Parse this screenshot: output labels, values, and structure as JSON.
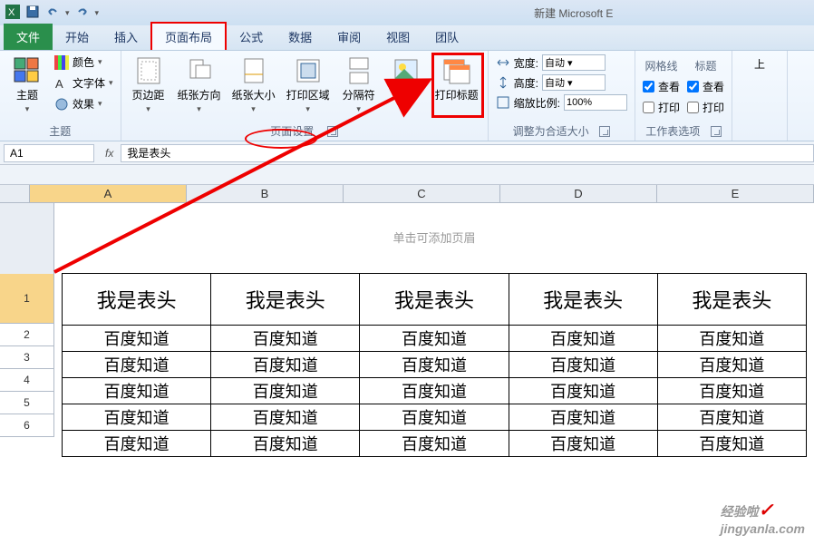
{
  "title": "新建 Microsoft E",
  "qat": {
    "save": "保存",
    "undo": "撤销",
    "redo": "重做"
  },
  "tabs": {
    "file": "文件",
    "home": "开始",
    "insert": "插入",
    "layout": "页面布局",
    "formulas": "公式",
    "data": "数据",
    "review": "审阅",
    "view": "视图",
    "team": "团队"
  },
  "ribbon": {
    "themes": {
      "theme": "主题",
      "colors": "颜色",
      "fonts": "文字体",
      "effects": "效果",
      "group": "主题"
    },
    "page_setup": {
      "margins": "页边距",
      "orientation": "纸张方向",
      "size": "纸张大小",
      "print_area": "打印区域",
      "breaks": "分隔符",
      "background": "背景",
      "print_titles": "打印标题",
      "group": "页面设置"
    },
    "scale": {
      "width_label": "宽度:",
      "width_value": "自动",
      "height_label": "高度:",
      "height_value": "自动",
      "scale_label": "缩放比例:",
      "scale_value": "100%",
      "group": "调整为合适大小"
    },
    "sheet_options": {
      "gridlines": "网格线",
      "headings": "标题",
      "view": "查看",
      "print": "打印",
      "group": "工作表选项"
    },
    "arrange": {
      "bring_forward": "上"
    }
  },
  "namebox": "A1",
  "formula": "我是表头",
  "fx": "fx",
  "columns": [
    "A",
    "B",
    "C",
    "D",
    "E"
  ],
  "rows": [
    "1",
    "2",
    "3",
    "4",
    "5",
    "6"
  ],
  "page_header_hint": "单击可添加页眉",
  "table": {
    "header": [
      "我是表头",
      "我是表头",
      "我是表头",
      "我是表头",
      "我是表头"
    ],
    "body": [
      [
        "百度知道",
        "百度知道",
        "百度知道",
        "百度知道",
        "百度知道"
      ],
      [
        "百度知道",
        "百度知道",
        "百度知道",
        "百度知道",
        "百度知道"
      ],
      [
        "百度知道",
        "百度知道",
        "百度知道",
        "百度知道",
        "百度知道"
      ],
      [
        "百度知道",
        "百度知道",
        "百度知道",
        "百度知道",
        "百度知道"
      ],
      [
        "百度知道",
        "百度知道",
        "百度知道",
        "百度知道",
        "百度知道"
      ]
    ]
  },
  "watermark": "jingyanla.com",
  "watermark_top": "经验啦"
}
